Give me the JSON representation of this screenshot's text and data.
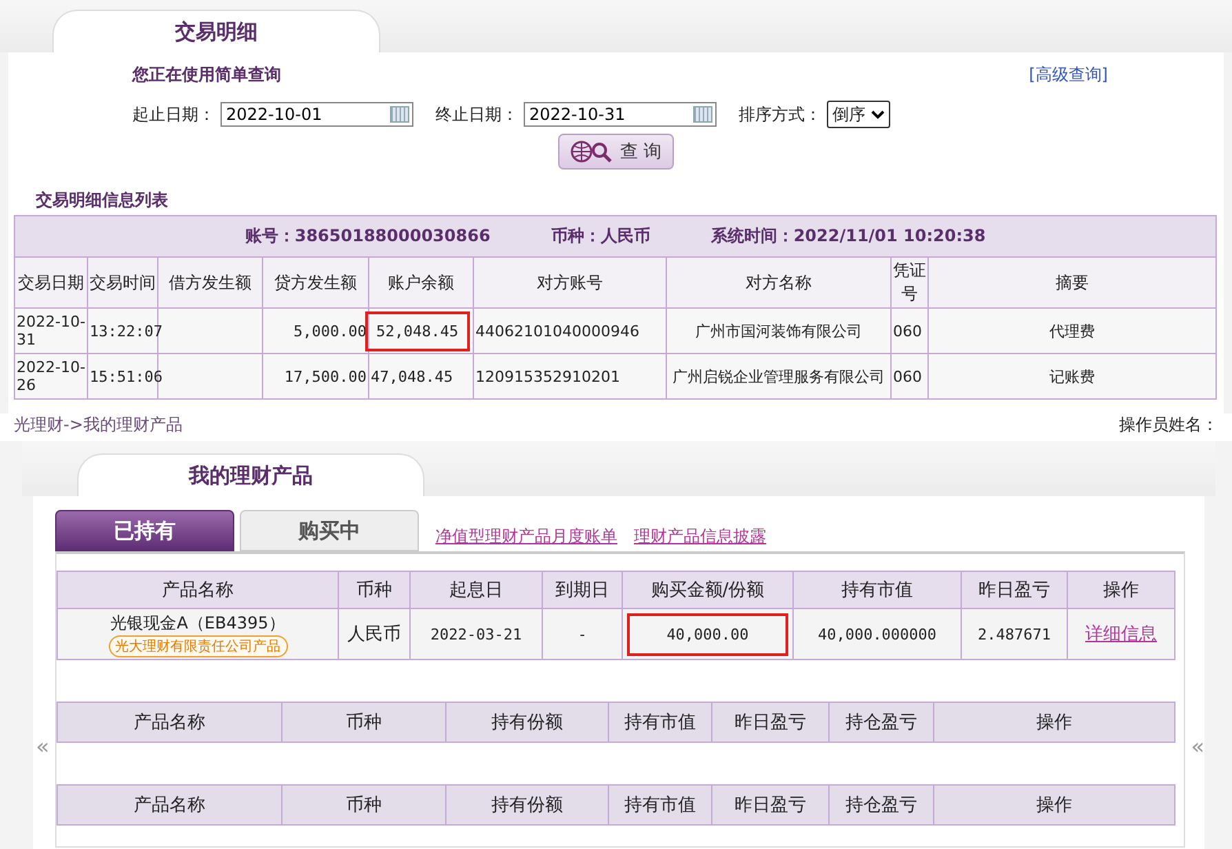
{
  "top_panel": {
    "tab": "交易明细",
    "query_mode": "您正在使用简单查询",
    "advanced_link": "[高级查询]",
    "start_label": "起止日期：",
    "start_value": "2022-10-01",
    "end_label": "终止日期：",
    "end_value": "2022-10-31",
    "sort_label": "排序方式：",
    "sort_value": "倒序",
    "query_button": "查 询",
    "list_title": "交易明细信息列表",
    "info": [
      "账号：38650188000030866",
      "币种：人民币",
      "系统时间：2022/11/01  10:20:38"
    ],
    "table": {
      "columns": [
        "交易日期",
        "交易时间",
        "借方发生额",
        "贷方发生额",
        "账户余额",
        "对方账号",
        "对方名称",
        "凭证号",
        "摘要"
      ],
      "rows": [
        {
          "cells": [
            "2022-10-31",
            "13:22:07",
            "",
            "5,000.00",
            "52,048.45",
            "44062101040000946",
            "广州市国河装饰有限公司",
            "060",
            "代理费"
          ],
          "highlighted": [
            false,
            false,
            false,
            false,
            true,
            false,
            false,
            false,
            false
          ]
        },
        {
          "cells": [
            "2022-10-26",
            "15:51:06",
            "",
            "17,500.00",
            "47,048.45",
            "120915352910201",
            "广州启锐企业管理服务有限公司",
            "060",
            "记账费"
          ],
          "highlighted": [
            false,
            false,
            false,
            false,
            false,
            false,
            false,
            false,
            false
          ]
        }
      ]
    }
  },
  "breadcrumb": "光理财->我的理财产品",
  "operator_label": "操作员姓名：",
  "bottom_panel": {
    "tab": "我的理财产品",
    "tabs": [
      {
        "label": "已持有",
        "selected": true
      },
      {
        "label": "购买中",
        "selected": false
      }
    ],
    "links": [
      "净值型理财产品月度账单",
      "理财产品信息披露"
    ],
    "table": {
      "columns": [
        "产品名称",
        "币种",
        "起息日",
        "到期日",
        "购买金额/份额",
        "持有市值",
        "昨日盈亏",
        "操作"
      ],
      "rows": [
        {
          "issuer_tag": "光大理财有限责任公司产品",
          "cells": [
            "光银现金A（EB4395）",
            "人民币",
            "2022-03-21",
            "-",
            "40,000.00",
            "40,000.000000",
            "2.487671",
            "详细信息"
          ],
          "highlighted": [
            false,
            false,
            false,
            false,
            true,
            false,
            false,
            false
          ]
        }
      ]
    },
    "empty_tables": [
      {
        "columns": [
          "产品名称",
          "币种",
          "持有份额",
          "持有市值",
          "昨日盈亏",
          "持仓盈亏",
          "操作"
        ]
      },
      {
        "columns": [
          "产品名称",
          "币种",
          "持有份额",
          "持有市值",
          "昨日盈亏",
          "持仓盈亏",
          "操作"
        ]
      }
    ],
    "side_arrows": [
      "«",
      "«"
    ]
  }
}
